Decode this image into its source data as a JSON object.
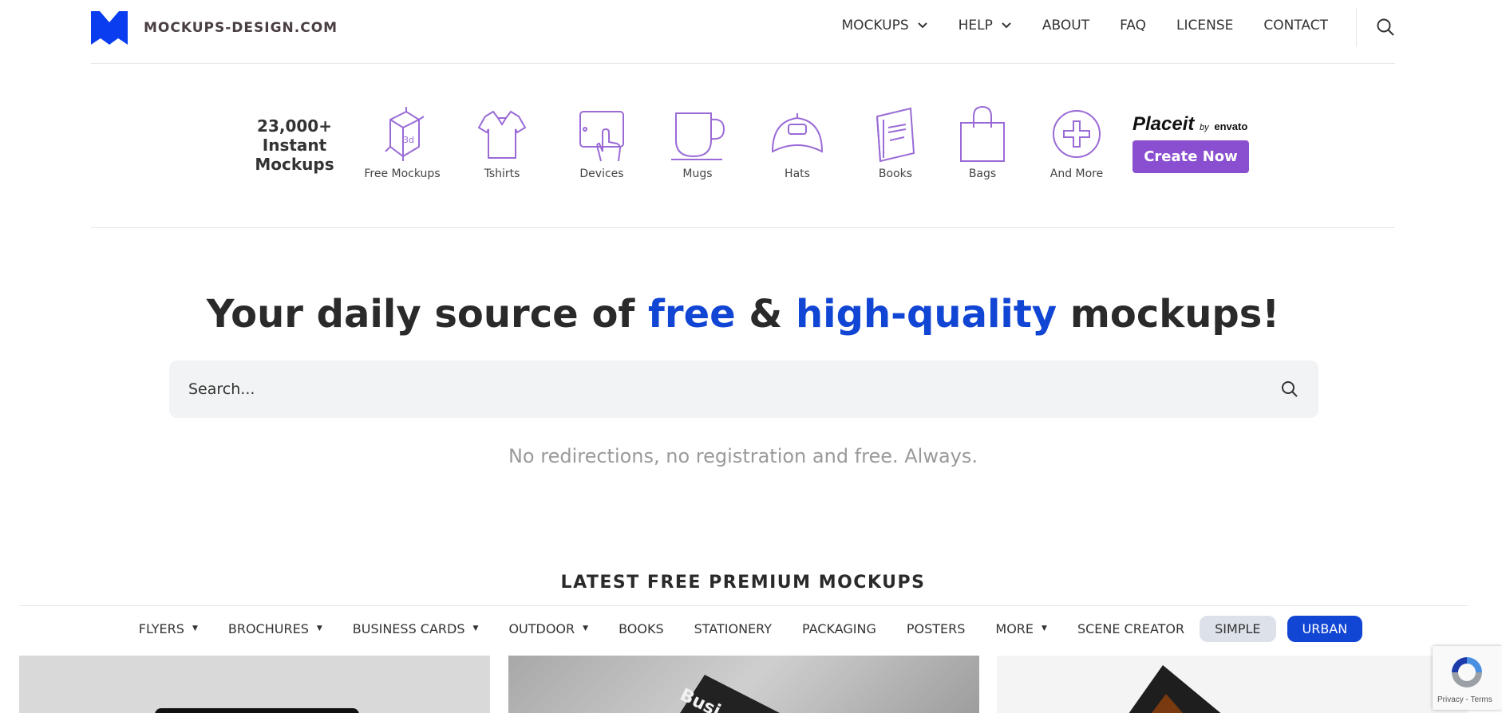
{
  "brand": {
    "logo_text": "MOCKUPS-DESIGN.COM",
    "accent_color": "#1145d4",
    "logo_color": "#0a3df0"
  },
  "nav": {
    "items": [
      {
        "label": "MOCKUPS",
        "has_dropdown": true
      },
      {
        "label": "HELP",
        "has_dropdown": true
      },
      {
        "label": "ABOUT",
        "has_dropdown": false
      },
      {
        "label": "FAQ",
        "has_dropdown": false
      },
      {
        "label": "LICENSE",
        "has_dropdown": false
      },
      {
        "label": "CONTACT",
        "has_dropdown": false
      }
    ],
    "search_icon": "search-icon"
  },
  "banner": {
    "headline": "23,000+ Instant Mockups",
    "categories": [
      {
        "label": "Free Mockups",
        "icon": "3d-box-icon"
      },
      {
        "label": "Tshirts",
        "icon": "tshirt-icon"
      },
      {
        "label": "Devices",
        "icon": "tablet-icon"
      },
      {
        "label": "Mugs",
        "icon": "mug-icon"
      },
      {
        "label": "Hats",
        "icon": "cap-icon"
      },
      {
        "label": "Books",
        "icon": "book-icon"
      },
      {
        "label": "Bags",
        "icon": "bag-icon"
      },
      {
        "label": "And More",
        "icon": "plus-icon"
      }
    ],
    "placeit_logo": "Placeit",
    "placeit_by": "by",
    "placeit_partner": "envato",
    "cta_label": "Create Now",
    "cta_color": "#8a4fd0"
  },
  "hero": {
    "title_part1": "Your daily source of ",
    "title_free": "free",
    "title_amp": " & ",
    "title_hq": "high-quality",
    "title_part2": " mockups!",
    "search_placeholder": "Search...",
    "tagline": "No redirections, no registration and free. Always."
  },
  "latest": {
    "heading": "LATEST FREE PREMIUM MOCKUPS",
    "categories": [
      {
        "label": "FLYERS",
        "has_dropdown": true
      },
      {
        "label": "BROCHURES",
        "has_dropdown": true
      },
      {
        "label": "BUSINESS CARDS",
        "has_dropdown": true
      },
      {
        "label": "OUTDOOR",
        "has_dropdown": true
      },
      {
        "label": "BOOKS",
        "has_dropdown": false
      },
      {
        "label": "STATIONERY",
        "has_dropdown": false
      },
      {
        "label": "PACKAGING",
        "has_dropdown": false
      },
      {
        "label": "POSTERS",
        "has_dropdown": false
      },
      {
        "label": "MORE",
        "has_dropdown": true
      },
      {
        "label": "SCENE CREATOR",
        "has_dropdown": false
      }
    ],
    "style_toggle": {
      "simple": "SIMPLE",
      "urban": "URBAN",
      "selected": "URBAN"
    },
    "card2_text": "Busi"
  },
  "recaptcha": {
    "links": "Privacy - Terms"
  }
}
